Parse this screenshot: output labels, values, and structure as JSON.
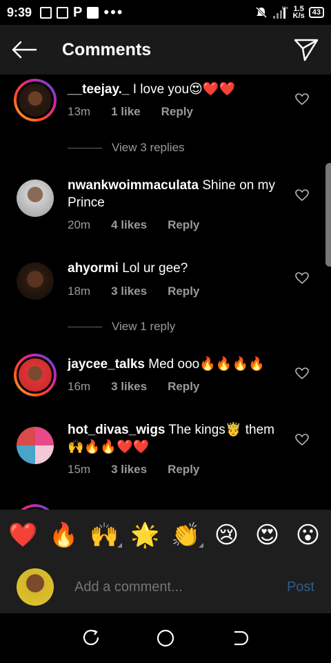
{
  "status": {
    "time": "9:39",
    "network_speed": "1.5",
    "network_unit": "K/s",
    "battery": "43",
    "dots": "•••"
  },
  "header": {
    "title": "Comments"
  },
  "comments": [
    {
      "username": "__teejay._",
      "text": " I love you😍❤️❤️",
      "time": "13m",
      "likes": "1 like",
      "reply": "Reply"
    },
    {
      "username": "nwankwoimmaculata",
      "text": " Shine on my Prince",
      "time": "20m",
      "likes": "4 likes",
      "reply": "Reply"
    },
    {
      "username": "ahyormi",
      "text": " Lol ur gee?",
      "time": "18m",
      "likes": "3 likes",
      "reply": "Reply"
    },
    {
      "username": "jaycee_talks",
      "text": " Med ooo🔥🔥🔥🔥",
      "time": "16m",
      "likes": "3 likes",
      "reply": "Reply"
    },
    {
      "username": "hot_divas_wigs",
      "text": " The kings🤴 them🙌🔥🔥❤️❤️",
      "time": "15m",
      "likes": "3 likes",
      "reply": "Reply"
    }
  ],
  "view_replies": [
    "View 3 replies",
    "View 1 reply"
  ],
  "emoji_bar": [
    "❤️",
    "🔥",
    "🙌",
    "🌟",
    "👏",
    "😢",
    "😍",
    "😮"
  ],
  "composer": {
    "placeholder": "Add a comment...",
    "post_label": "Post"
  },
  "colors": {
    "header_bg": "#1a1a1a",
    "meta_text": "#9a9a9a",
    "post_disabled": "#2f5c8f"
  }
}
